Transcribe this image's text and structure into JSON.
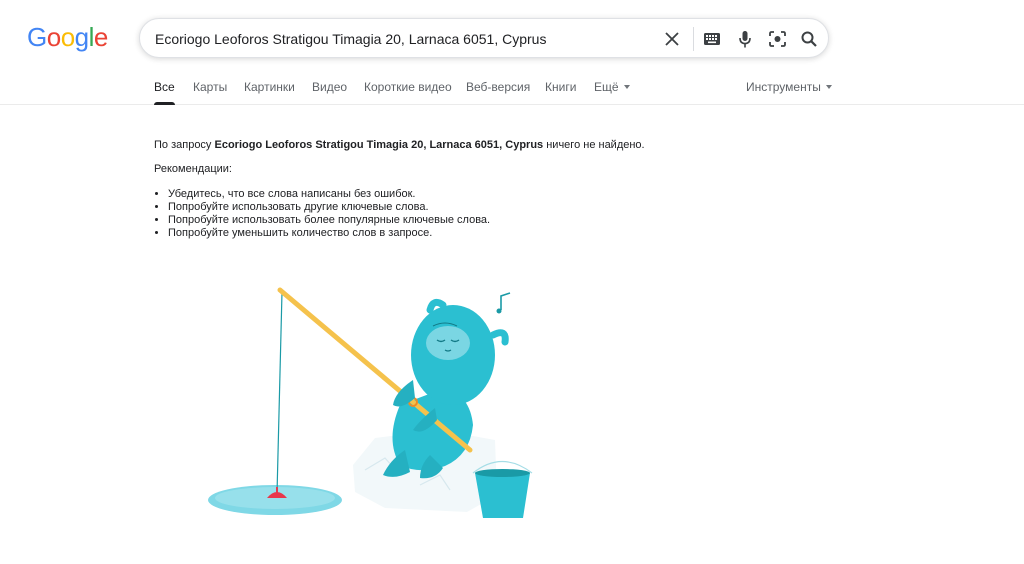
{
  "logo": {
    "letters": [
      "G",
      "o",
      "o",
      "g",
      "l",
      "e"
    ],
    "colors": [
      "#4285F4",
      "#EA4335",
      "#FBBC05",
      "#4285F4",
      "#34A853",
      "#EA4335"
    ]
  },
  "search": {
    "query": "Ecoriogo Leoforos Stratigou Timagia 20, Larnaca 6051, Cyprus"
  },
  "tabs": [
    {
      "label": "Все"
    },
    {
      "label": "Карты"
    },
    {
      "label": "Картинки"
    },
    {
      "label": "Видео"
    },
    {
      "label": "Короткие видео"
    },
    {
      "label": "Веб-версия"
    },
    {
      "label": "Книги"
    },
    {
      "label": "Ещё"
    }
  ],
  "tools_label": "Инструменты",
  "results": {
    "prefix": "По запросу ",
    "query_bold": "Ecoriogo Leoforos Stratigou Timagia 20, Larnaca 6051, Cyprus",
    "suffix": " ничего не найдено.",
    "recommendations_title": "Рекомендации:",
    "recommendations": [
      "Убедитесь, что все слова написаны без ошибок.",
      "Попробуйте использовать другие ключевые слова.",
      "Попробуйте использовать более популярные ключевые слова.",
      "Попробуйте уменьшить количество слов в запросе."
    ]
  },
  "icons": [
    "clear-icon",
    "keyboard-icon",
    "microphone-icon",
    "camera-lens-icon",
    "search-icon"
  ],
  "colors": {
    "accent": "#1a73e8",
    "yeti": "#2bbfd1",
    "rod": "#f5c24c"
  }
}
